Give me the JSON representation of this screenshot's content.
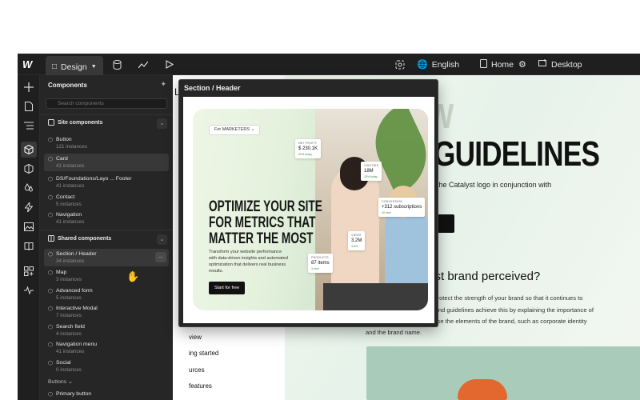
{
  "topbar": {
    "logo": "W",
    "mode_label": "Design",
    "language": "English",
    "page": "Home",
    "breakpoint": "Desktop"
  },
  "panel": {
    "title": "Components",
    "search_placeholder": "Search components",
    "site_section": "Site components",
    "site_items": [
      {
        "name": "Button",
        "instances": "121 instances"
      },
      {
        "name": "Card",
        "instances": "41 instances"
      },
      {
        "name": "DS/Foundations/Layo ... Footer",
        "instances": "41 instances"
      },
      {
        "name": "Contact",
        "instances": "5 instances"
      },
      {
        "name": "Navigation",
        "instances": "41 instances"
      }
    ],
    "shared_section": "Shared components",
    "shared_items": [
      {
        "name": "Section / Header",
        "instances": "34 instances"
      },
      {
        "name": "Map",
        "instances": "3 instances"
      },
      {
        "name": "Advanced form",
        "instances": "5 instances"
      },
      {
        "name": "Interactive Modal",
        "instances": "7 instances"
      },
      {
        "name": "Search field",
        "instances": "4 instances"
      },
      {
        "name": "Navigation menu",
        "instances": "41 instances"
      },
      {
        "name": "Social",
        "instances": "0 instances"
      }
    ],
    "buttons_group": "Buttons",
    "buttons_items": [
      {
        "name": "Primary button"
      }
    ],
    "more_label": "..."
  },
  "popover": {
    "title": "Section / Header",
    "preview": {
      "dropdown": "For MARKETERS",
      "headline": [
        "OPTIMIZE YOUR SITE",
        "FOR METRICS THAT",
        "MATTER THE MOST"
      ],
      "body": [
        "Transform your website performance",
        "with data-driven insights and automated",
        "optimization that delivers real business",
        "results."
      ],
      "cta": "Start for free",
      "stats": [
        {
          "label": "NET PROFIT",
          "value": "$ 230.1K",
          "delta": "22% today"
        },
        {
          "label": "VISITORS",
          "value": "18M",
          "delta": "15% today"
        },
        {
          "label": "CONVERSION",
          "value": "+312 subscriptions",
          "delta": "10 new"
        },
        {
          "label": "VIEWS",
          "value": "3.2M",
          "delta": "3.6%"
        },
        {
          "label": "PRODUCTS",
          "value": "87 items",
          "delta": "3 new"
        }
      ]
    }
  },
  "canvas": {
    "hero_line1": "W",
    "hero_line2": "GUIDELINES",
    "hero_text": "the Catalyst logo in conjunction with",
    "hero_btn": "nd",
    "section_title": "yst brand perceived?",
    "paragraph": [
      "o protect the strength of your brand so that it continues to",
      "Brand guidelines achieve this by explaining the importance of",
      "o use the elements of the brand, such as corporate identity",
      "and the brand name."
    ],
    "left_label": "L",
    "nav_rows": [
      {
        "label": "view"
      },
      {
        "label": "ing started",
        "icon": "+"
      },
      {
        "label": "urces",
        "icon": "+"
      },
      {
        "label": "features",
        "icon": "+"
      }
    ]
  }
}
